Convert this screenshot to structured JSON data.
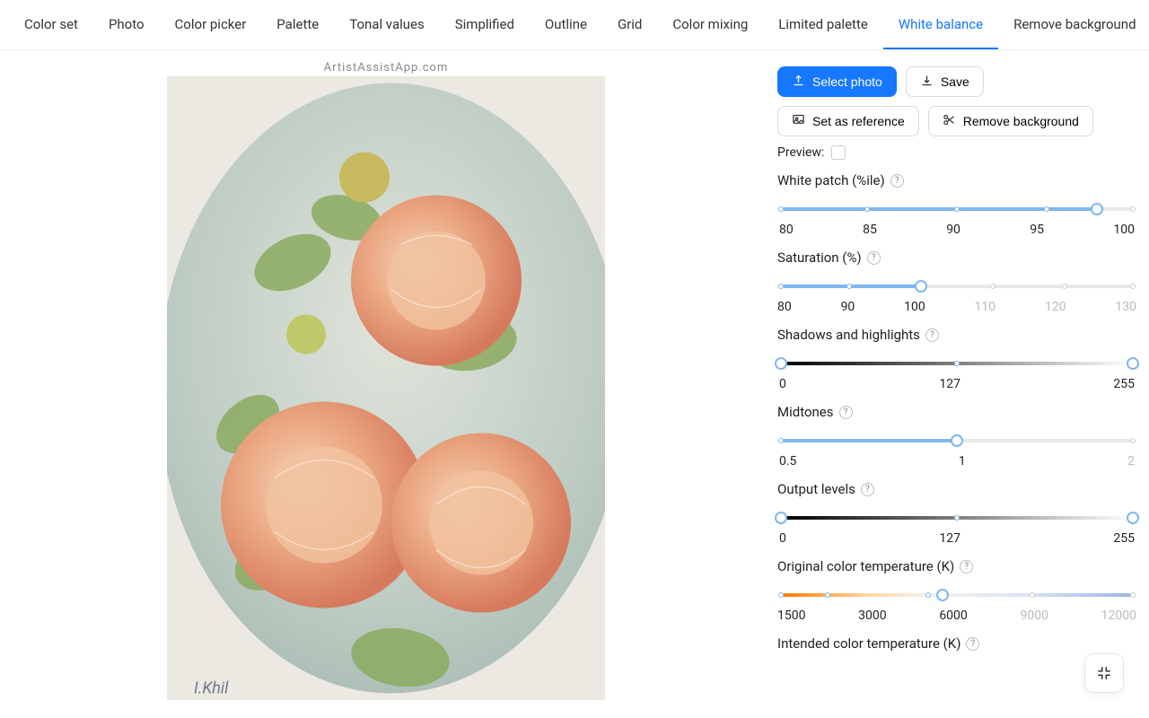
{
  "watermark": "ArtistAssistApp.com",
  "tabs": [
    {
      "label": "Color set"
    },
    {
      "label": "Photo"
    },
    {
      "label": "Color picker"
    },
    {
      "label": "Palette"
    },
    {
      "label": "Tonal values"
    },
    {
      "label": "Simplified"
    },
    {
      "label": "Outline"
    },
    {
      "label": "Grid"
    },
    {
      "label": "Color mixing"
    },
    {
      "label": "Limited palette"
    },
    {
      "label": "White balance",
      "active": true
    },
    {
      "label": "Remove background"
    }
  ],
  "buttons": {
    "select_photo": "Select photo",
    "save": "Save",
    "set_as_reference": "Set as reference",
    "remove_background": "Remove background"
  },
  "preview_label": "Preview:",
  "controls": {
    "white_patch": {
      "label": "White patch (%ile)",
      "ticks": [
        "80",
        "85",
        "90",
        "95",
        "100"
      ],
      "value_pct": 89
    },
    "saturation": {
      "label": "Saturation (%)",
      "ticks": [
        "80",
        "90",
        "100",
        "110",
        "120",
        "130"
      ],
      "value_pct": 40
    },
    "shadows_highlights": {
      "label": "Shadows and highlights",
      "ticks": [
        "0",
        "127",
        "255"
      ]
    },
    "midtones": {
      "label": "Midtones",
      "ticks": [
        "0.5",
        "1",
        "2"
      ],
      "value_pct": 50
    },
    "output_levels": {
      "label": "Output levels",
      "ticks": [
        "0",
        "127",
        "255"
      ]
    },
    "orig_temp": {
      "label": "Original color temperature (K)",
      "ticks": [
        "1500",
        "3000",
        "6000",
        "9000",
        "12000"
      ],
      "value_pct": 46
    },
    "intended_temp": {
      "label": "Intended color temperature (K)"
    }
  }
}
